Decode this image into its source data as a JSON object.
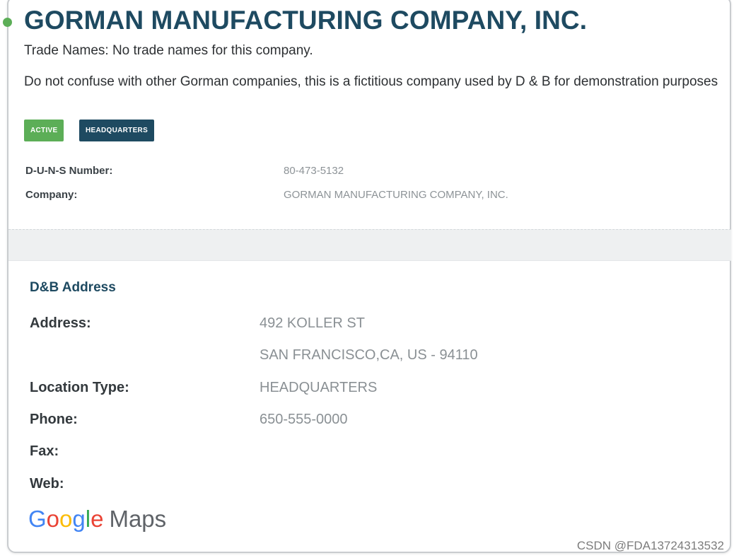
{
  "company": {
    "title": "GORMAN MANUFACTURING COMPANY, INC.",
    "trade_names": "Trade Names: No trade names for this company.",
    "disclaimer": "Do not confuse with other Gorman companies, this is a fictitious company used by D & B for demonstration purposes"
  },
  "badges": {
    "status": "ACTIVE",
    "type": "HEADQUARTERS"
  },
  "details": {
    "duns_label": "D-U-N-S Number:",
    "duns_value": "80-473-5132",
    "company_label": "Company:",
    "company_value": "GORMAN MANUFACTURING COMPANY, INC."
  },
  "address_section": {
    "heading": "D&B Address",
    "address_label": "Address:",
    "address_line1": "492 KOLLER ST",
    "address_line2": "SAN FRANCISCO,CA, US - 94110",
    "location_type_label": "Location Type:",
    "location_type_value": "HEADQUARTERS",
    "phone_label": "Phone:",
    "phone_value": "650-555-0000",
    "fax_label": "Fax:",
    "web_label": "Web:"
  },
  "map_link": {
    "google_g": "G",
    "google_o1": "o",
    "google_o2": "o",
    "google_g2": "g",
    "google_l": "l",
    "google_e": "e",
    "maps": "Maps"
  },
  "watermark": "CSDN @FDA13724313532",
  "colors": {
    "brand": "#1e4a61",
    "active": "#5cae57"
  }
}
